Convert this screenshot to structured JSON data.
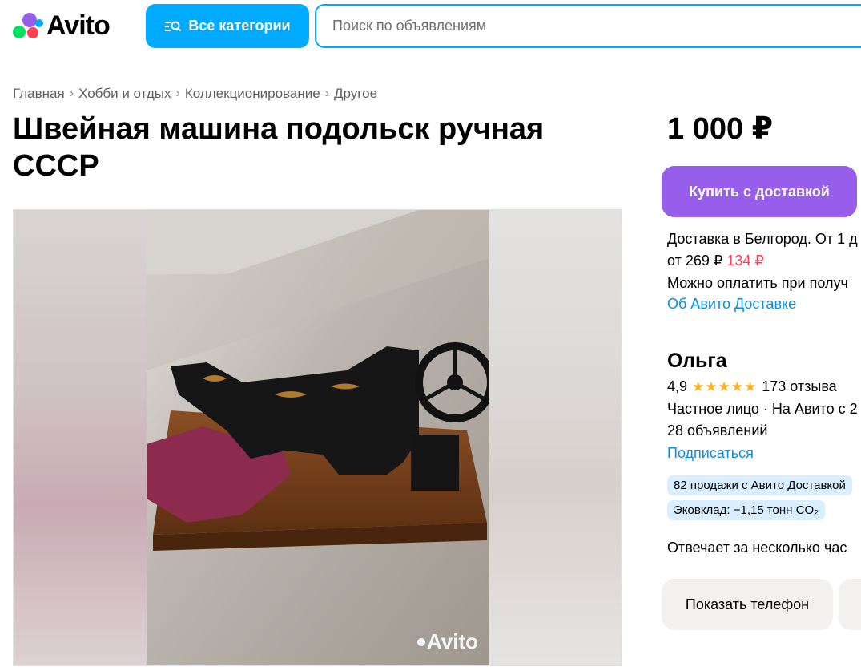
{
  "header": {
    "logo_text": "Avito",
    "categories_button": "Все категории",
    "search_placeholder": "Поиск по объявлениям"
  },
  "breadcrumb": [
    "Главная",
    "Хобби и отдых",
    "Коллекционирование",
    "Другое"
  ],
  "listing": {
    "title": "Швейная машина подольск ручная СССР",
    "price": "1 000 ₽",
    "photo_watermark": "Avito"
  },
  "delivery": {
    "buy_button": "Купить с доставкой",
    "line1": "Доставка в Белгород. От 1 д",
    "price_prefix": "от",
    "old_price": "269 ₽",
    "new_price": "134 ₽",
    "line3": "Можно оплатить при получ",
    "link": "Об Авито Доставке"
  },
  "seller": {
    "name": "Ольга",
    "rating": "4,9",
    "stars": "★★★★★",
    "reviews": "173 отзыва",
    "info": "Частное лицо · На Авито с 2",
    "ads_count": "28 объявлений",
    "subscribe": "Подписаться",
    "badge_sales": "82 продажи с Авито Доставкой",
    "badge_eco": "Эковклад: −1,15 тонн CO₂",
    "response": "Отвечает за несколько час",
    "phone_button": "Показать телефон"
  },
  "colors": {
    "accent_blue": "#00aaff",
    "buy_purple": "#965eeb",
    "link_blue": "#0a8ee0",
    "sale_red": "#ff4053",
    "star_yellow": "#ffb021"
  }
}
